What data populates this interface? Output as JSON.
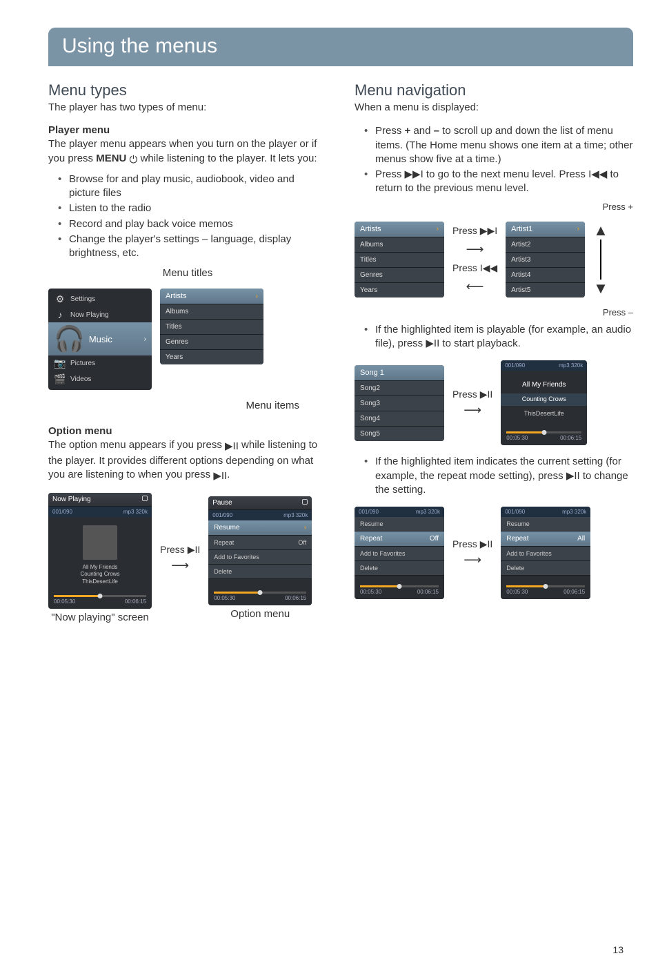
{
  "page": {
    "title": "Using the menus",
    "number": "13"
  },
  "left": {
    "h2": "Menu types",
    "intro": "The player has two types of menu:",
    "player_menu": {
      "heading": "Player menu",
      "body1": "The player menu appears when you turn on the player or if you press ",
      "body1_bold": "MENU",
      "body1_after": " while listening to the player. It lets you:",
      "bullets": [
        "Browse for and play music, audiobook, video and picture files",
        "Listen to the radio",
        "Record and play back voice memos",
        "Change the player's settings – language, display brightness, etc."
      ],
      "menu_titles_label": "Menu titles",
      "menu_items_label": "Menu items",
      "home": {
        "items": [
          "Settings",
          "Now Playing",
          "Music",
          "Pictures",
          "Videos"
        ],
        "selected_index": 2
      },
      "sub": {
        "items": [
          "Artists",
          "Albums",
          "Titles",
          "Genres",
          "Years"
        ],
        "selected_index": 0
      }
    },
    "option_menu": {
      "heading": "Option menu",
      "body": "The option menu appears if you press     while listening to the player. It provides different options depending on what you are listening to when you press    .",
      "press_label": "Press",
      "now_playing_label": "\"Now playing\" screen",
      "option_menu_label": "Option menu",
      "np": {
        "header": "Now Playing",
        "track_index": "001/090",
        "bitrate": "mp3 320k",
        "line1": "All My Friends",
        "line2": "Counting Crows",
        "line3": "ThisDesertLife",
        "t_elapsed": "00:05:30",
        "t_total": "00:06:15"
      },
      "opt": {
        "header": "Pause",
        "track_index": "001/090",
        "bitrate": "mp3 320k",
        "items": [
          {
            "label": "Resume",
            "value": "",
            "sel": true,
            "chev": true
          },
          {
            "label": "Repeat",
            "value": "Off"
          },
          {
            "label": "Add to Favorites",
            "value": ""
          },
          {
            "label": "Delete",
            "value": ""
          }
        ],
        "t_elapsed": "00:05:30",
        "t_total": "00:06:15"
      }
    }
  },
  "right": {
    "h2": "Menu navigation",
    "intro": "When a menu is displayed:",
    "bullets": [
      "Press + and – to scroll up and down the list of menu items. (The Home menu shows one item at a time; other menus show five at a time.)",
      "Press     to go to the next menu level. Press     to return to the previous menu level."
    ],
    "diagram1": {
      "press_plus": "Press +",
      "press_minus": "Press –",
      "press_next": "Press",
      "press_prev": "Press",
      "left_menu": [
        "Artists",
        "Albums",
        "Titles",
        "Genres",
        "Years"
      ],
      "right_menu": [
        "Artist1",
        "Artist2",
        "Artist3",
        "Artist4",
        "Artist5"
      ]
    },
    "bullet3": "If the highlighted item is playable (for example, an audio file), press     to start playback.",
    "diagram2": {
      "press_label": "Press",
      "left_menu": [
        "Song 1",
        "Song2",
        "Song3",
        "Song4",
        "Song5"
      ],
      "np": {
        "track_index": "001/090",
        "bitrate": "mp3 320k",
        "line1": "All My Friends",
        "line2": "Counting Crows",
        "line3": "ThisDesertLife",
        "t_elapsed": "00:05:30",
        "t_total": "00:06:15"
      }
    },
    "bullet4": "If the highlighted item indicates the current setting (for example, the repeat mode setting), press     to change the setting.",
    "diagram3": {
      "press_label": "Press",
      "left": {
        "track_index": "001/090",
        "bitrate": "mp3 320k",
        "items": [
          {
            "label": "Resume"
          },
          {
            "label": "Repeat",
            "value": "Off",
            "sel": true
          },
          {
            "label": "Add to Favorites"
          },
          {
            "label": "Delete"
          }
        ],
        "t_elapsed": "00:05:30",
        "t_total": "00:06:15"
      },
      "right": {
        "track_index": "001/090",
        "bitrate": "mp3 320k",
        "items": [
          {
            "label": "Resume"
          },
          {
            "label": "Repeat",
            "value": "All",
            "sel": true
          },
          {
            "label": "Add to Favorites"
          },
          {
            "label": "Delete"
          }
        ],
        "t_elapsed": "00:05:30",
        "t_total": "00:06:15"
      }
    }
  },
  "icons": {
    "play_pause": "▶II",
    "power": "⏻",
    "next": "▶▶I",
    "prev": "I◀◀",
    "chev": "›"
  }
}
